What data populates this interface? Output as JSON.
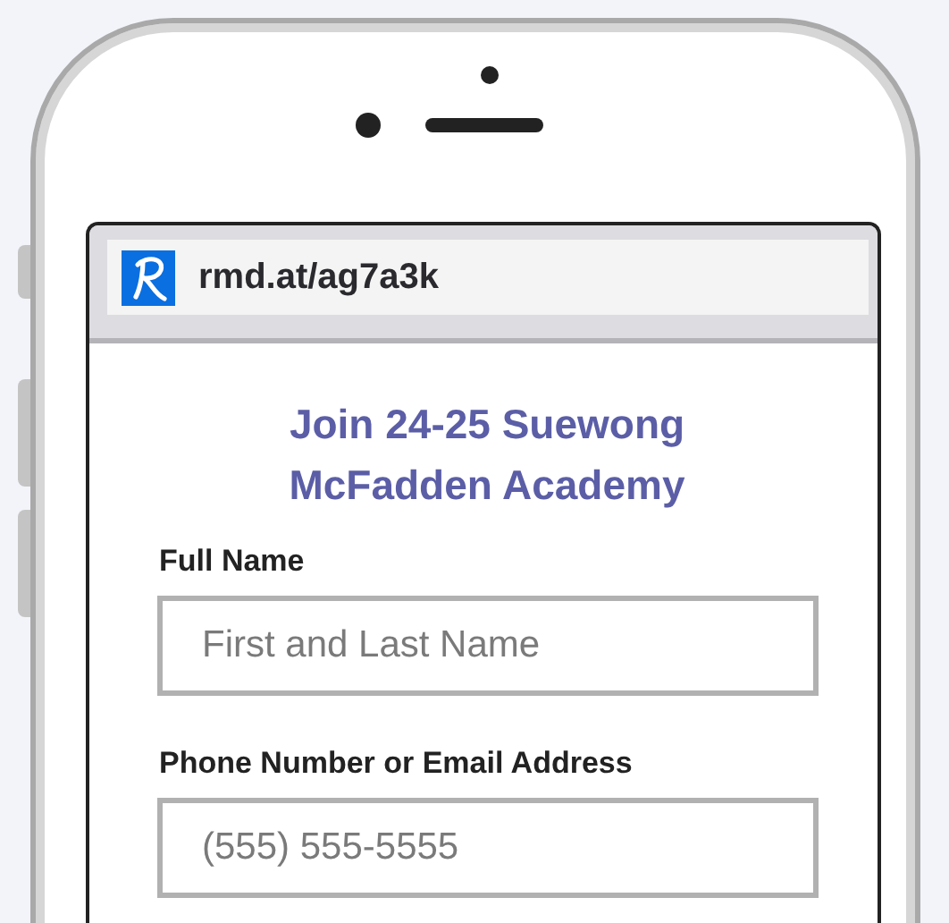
{
  "browser": {
    "url": "rmd.at/ag7a3k"
  },
  "form": {
    "title": "Join 24-25 Suewong McFadden Academy",
    "fields": [
      {
        "label": "Full Name",
        "placeholder": "First and Last Name"
      },
      {
        "label": "Phone Number or Email Address",
        "placeholder": "(555) 555-5555"
      }
    ]
  }
}
